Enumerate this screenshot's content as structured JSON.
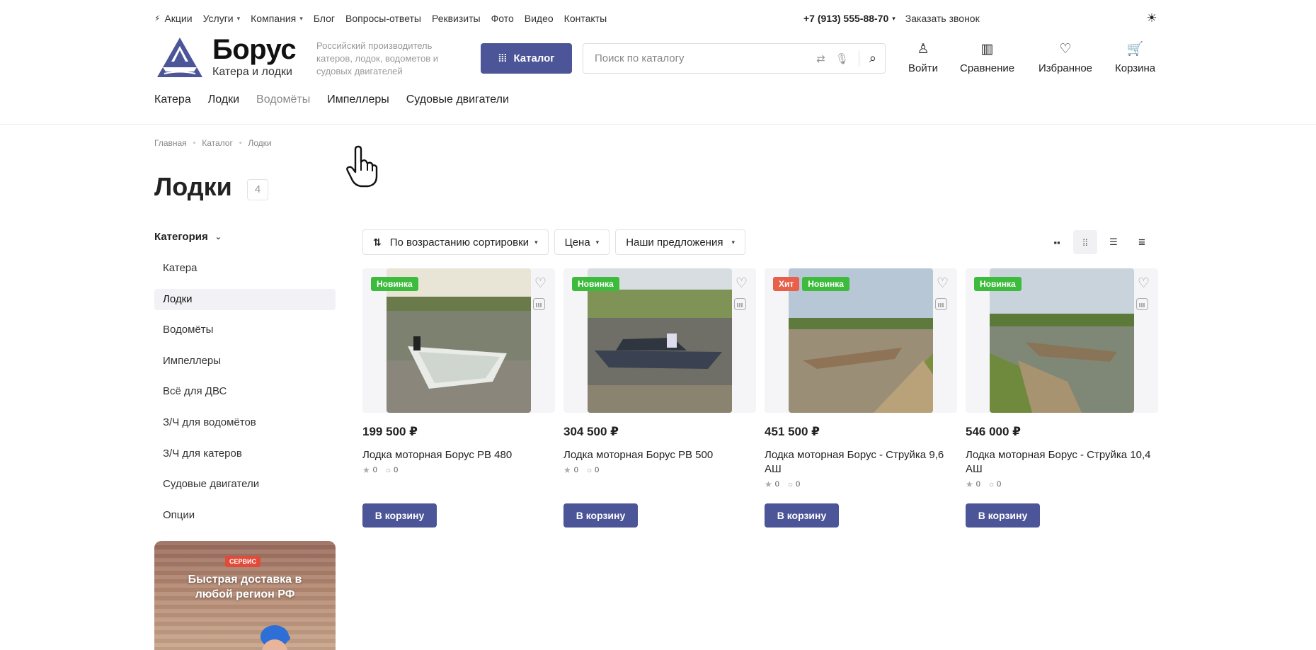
{
  "topline": {
    "promo": "Акции",
    "services": "Услуги",
    "company": "Компания",
    "blog": "Блог",
    "faq": "Вопросы-ответы",
    "requisites": "Реквизиты",
    "photo": "Фото",
    "video": "Видео",
    "contacts": "Контакты",
    "phone": "+7 (913) 555-88-70",
    "callback": "Заказать звонок"
  },
  "header": {
    "brand_name": "Борус",
    "brand_sub": "Катера и лодки",
    "tagline": "Российский производитель катеров, лодок, водометов и судовых двигателей",
    "catalog_label": "Каталог",
    "search_placeholder": "Поиск по каталогу",
    "login": "Войти",
    "compare": "Сравнение",
    "favorites": "Избранное",
    "cart": "Корзина"
  },
  "mainnav": [
    "Катера",
    "Лодки",
    "Водомёты",
    "Импеллеры",
    "Судовые двигатели"
  ],
  "breadcrumbs": [
    "Главная",
    "Каталог",
    "Лодки"
  ],
  "page": {
    "title": "Лодки",
    "count": "4"
  },
  "sidebar": {
    "heading": "Категория",
    "items": [
      "Катера",
      "Лодки",
      "Водомёты",
      "Импеллеры",
      "Всё для ДВС",
      "З/Ч для водомётов",
      "З/Ч для катеров",
      "Судовые двигатели",
      "Опции"
    ],
    "active_index": 1
  },
  "banner": {
    "tag": "СЕРВИС",
    "title": "Быстрая доставка в любой регион РФ"
  },
  "filters": {
    "sort": "По возрастанию сортировки",
    "price": "Цена",
    "offers": "Наши предложения"
  },
  "products": [
    {
      "badges": [
        "Новинка"
      ],
      "price": "199 500 ₽",
      "name": "Лодка моторная Борус РВ 480",
      "rating": "0",
      "reviews": "0",
      "button": "В корзину"
    },
    {
      "badges": [
        "Новинка"
      ],
      "price": "304 500 ₽",
      "name": "Лодка моторная Борус РВ 500",
      "rating": "0",
      "reviews": "0",
      "button": "В корзину"
    },
    {
      "badges": [
        "Хит",
        "Новинка"
      ],
      "price": "451 500 ₽",
      "name": "Лодка моторная Борус - Струйка 9,6 АШ",
      "rating": "0",
      "reviews": "0",
      "button": "В корзину"
    },
    {
      "badges": [
        "Новинка"
      ],
      "price": "546 000 ₽",
      "name": "Лодка моторная Борус - Струйка 10,4 АШ",
      "rating": "0",
      "reviews": "0",
      "button": "В корзину"
    }
  ],
  "colors": {
    "accent": "#4b5597",
    "badge_new": "#3dbb3d",
    "badge_hit": "#e8604a"
  }
}
